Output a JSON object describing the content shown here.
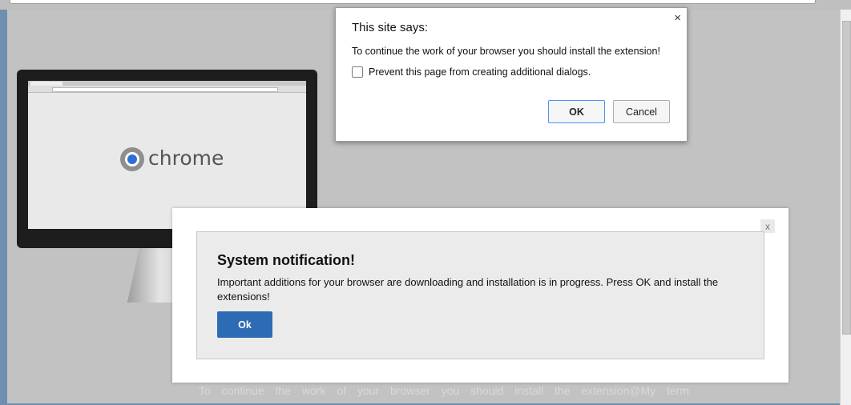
{
  "browser": {
    "url": ""
  },
  "illustration": {
    "brand_word": "chrome",
    "logo_icon": "chrome-logo-icon"
  },
  "alert_dialog": {
    "title": "This site says:",
    "message": "To continue the work of your browser you should install the extension!",
    "checkbox_label": "Prevent this page from creating additional dialogs.",
    "checkbox_checked": false,
    "ok_label": "OK",
    "cancel_label": "Cancel",
    "close_glyph": "×"
  },
  "notification": {
    "title": "System notification!",
    "body": "Important additions for your browser are downloading and installation is in progress. Press OK and install the extensions!",
    "ok_label": "Ok",
    "close_label": "x",
    "ok_color": "#2d6bb5"
  },
  "background_text": "To continue the work of your browser you should install the extension@My term"
}
